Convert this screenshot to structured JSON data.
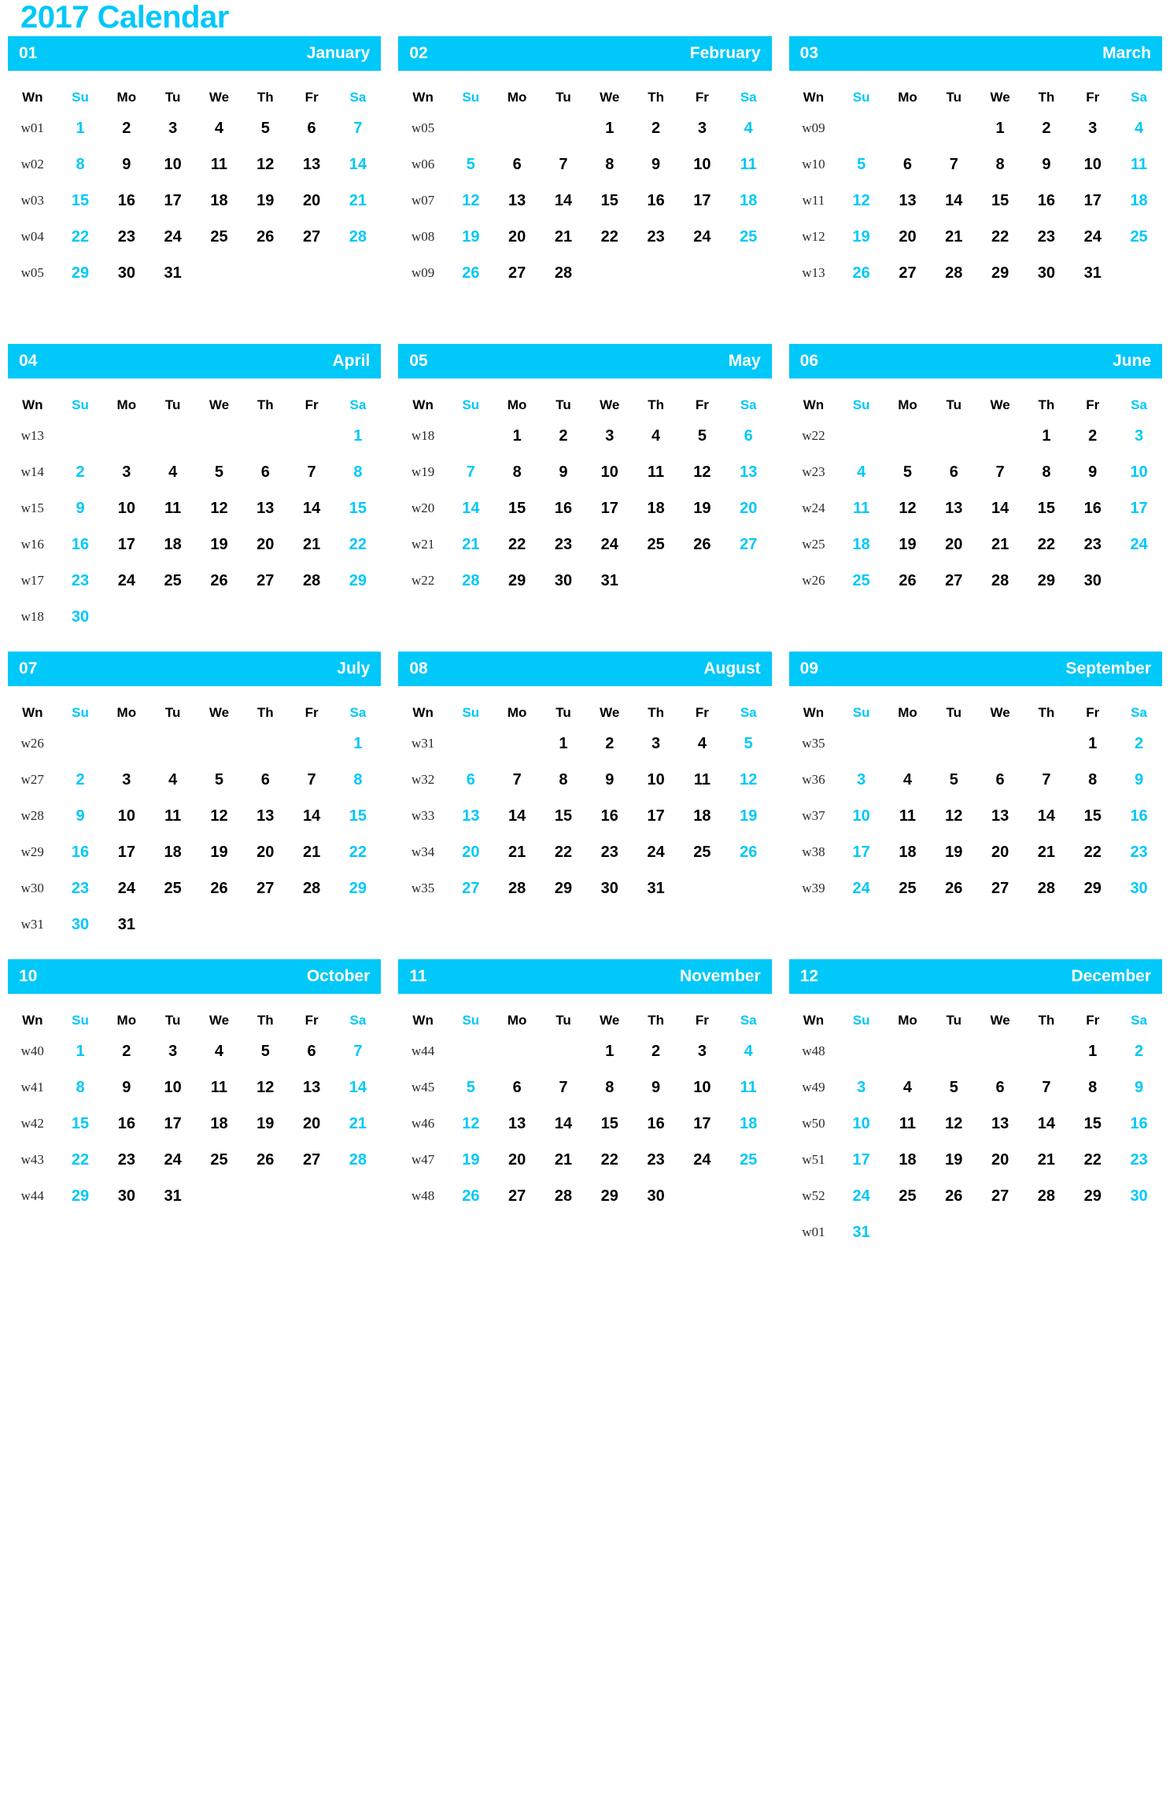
{
  "title": "2017 Calendar",
  "year": "2017",
  "colors": {
    "accent": "#00C8F8",
    "text": "#000000",
    "header_text": "#FFFFFF",
    "week_number": "#2B2B2B",
    "background": "#FFFFFF"
  },
  "day_headers": [
    {
      "label": "Wn",
      "weekend": false
    },
    {
      "label": "Su",
      "weekend": true
    },
    {
      "label": "Mo",
      "weekend": false
    },
    {
      "label": "Tu",
      "weekend": false
    },
    {
      "label": "We",
      "weekend": false
    },
    {
      "label": "Th",
      "weekend": false
    },
    {
      "label": "Fr",
      "weekend": false
    },
    {
      "label": "Sa",
      "weekend": true
    }
  ],
  "months": [
    {
      "num": "01",
      "name": "January",
      "weeks": [
        {
          "wn": "w01",
          "days": [
            "1",
            "2",
            "3",
            "4",
            "5",
            "6",
            "7"
          ]
        },
        {
          "wn": "w02",
          "days": [
            "8",
            "9",
            "10",
            "11",
            "12",
            "13",
            "14"
          ]
        },
        {
          "wn": "w03",
          "days": [
            "15",
            "16",
            "17",
            "18",
            "19",
            "20",
            "21"
          ]
        },
        {
          "wn": "w04",
          "days": [
            "22",
            "23",
            "24",
            "25",
            "26",
            "27",
            "28"
          ]
        },
        {
          "wn": "w05",
          "days": [
            "29",
            "30",
            "31",
            "",
            "",
            "",
            ""
          ]
        },
        {
          "wn": "",
          "days": [
            "",
            "",
            "",
            "",
            "",
            "",
            ""
          ]
        }
      ]
    },
    {
      "num": "02",
      "name": "February",
      "weeks": [
        {
          "wn": "w05",
          "days": [
            "",
            "",
            "",
            "1",
            "2",
            "3",
            "4"
          ]
        },
        {
          "wn": "w06",
          "days": [
            "5",
            "6",
            "7",
            "8",
            "9",
            "10",
            "11"
          ]
        },
        {
          "wn": "w07",
          "days": [
            "12",
            "13",
            "14",
            "15",
            "16",
            "17",
            "18"
          ]
        },
        {
          "wn": "w08",
          "days": [
            "19",
            "20",
            "21",
            "22",
            "23",
            "24",
            "25"
          ]
        },
        {
          "wn": "w09",
          "days": [
            "26",
            "27",
            "28",
            "",
            "",
            "",
            ""
          ]
        },
        {
          "wn": "",
          "days": [
            "",
            "",
            "",
            "",
            "",
            "",
            ""
          ]
        }
      ]
    },
    {
      "num": "03",
      "name": "March",
      "weeks": [
        {
          "wn": "w09",
          "days": [
            "",
            "",
            "",
            "1",
            "2",
            "3",
            "4"
          ]
        },
        {
          "wn": "w10",
          "days": [
            "5",
            "6",
            "7",
            "8",
            "9",
            "10",
            "11"
          ]
        },
        {
          "wn": "w11",
          "days": [
            "12",
            "13",
            "14",
            "15",
            "16",
            "17",
            "18"
          ]
        },
        {
          "wn": "w12",
          "days": [
            "19",
            "20",
            "21",
            "22",
            "23",
            "24",
            "25"
          ]
        },
        {
          "wn": "w13",
          "days": [
            "26",
            "27",
            "28",
            "29",
            "30",
            "31",
            ""
          ]
        },
        {
          "wn": "",
          "days": [
            "",
            "",
            "",
            "",
            "",
            "",
            ""
          ]
        }
      ]
    },
    {
      "num": "04",
      "name": "April",
      "weeks": [
        {
          "wn": "w13",
          "days": [
            "",
            "",
            "",
            "",
            "",
            "",
            "1"
          ]
        },
        {
          "wn": "w14",
          "days": [
            "2",
            "3",
            "4",
            "5",
            "6",
            "7",
            "8"
          ]
        },
        {
          "wn": "w15",
          "days": [
            "9",
            "10",
            "11",
            "12",
            "13",
            "14",
            "15"
          ]
        },
        {
          "wn": "w16",
          "days": [
            "16",
            "17",
            "18",
            "19",
            "20",
            "21",
            "22"
          ]
        },
        {
          "wn": "w17",
          "days": [
            "23",
            "24",
            "25",
            "26",
            "27",
            "28",
            "29"
          ]
        },
        {
          "wn": "w18",
          "days": [
            "30",
            "",
            "",
            "",
            "",
            "",
            ""
          ]
        }
      ]
    },
    {
      "num": "05",
      "name": "May",
      "weeks": [
        {
          "wn": "w18",
          "days": [
            "",
            "1",
            "2",
            "3",
            "4",
            "5",
            "6"
          ]
        },
        {
          "wn": "w19",
          "days": [
            "7",
            "8",
            "9",
            "10",
            "11",
            "12",
            "13"
          ]
        },
        {
          "wn": "w20",
          "days": [
            "14",
            "15",
            "16",
            "17",
            "18",
            "19",
            "20"
          ]
        },
        {
          "wn": "w21",
          "days": [
            "21",
            "22",
            "23",
            "24",
            "25",
            "26",
            "27"
          ]
        },
        {
          "wn": "w22",
          "days": [
            "28",
            "29",
            "30",
            "31",
            "",
            "",
            ""
          ]
        },
        {
          "wn": "",
          "days": [
            "",
            "",
            "",
            "",
            "",
            "",
            ""
          ]
        }
      ]
    },
    {
      "num": "06",
      "name": "June",
      "weeks": [
        {
          "wn": "w22",
          "days": [
            "",
            "",
            "",
            "",
            "1",
            "2",
            "3"
          ]
        },
        {
          "wn": "w23",
          "days": [
            "4",
            "5",
            "6",
            "7",
            "8",
            "9",
            "10"
          ]
        },
        {
          "wn": "w24",
          "days": [
            "11",
            "12",
            "13",
            "14",
            "15",
            "16",
            "17"
          ]
        },
        {
          "wn": "w25",
          "days": [
            "18",
            "19",
            "20",
            "21",
            "22",
            "23",
            "24"
          ]
        },
        {
          "wn": "w26",
          "days": [
            "25",
            "26",
            "27",
            "28",
            "29",
            "30",
            ""
          ]
        },
        {
          "wn": "",
          "days": [
            "",
            "",
            "",
            "",
            "",
            "",
            ""
          ]
        }
      ]
    },
    {
      "num": "07",
      "name": "July",
      "weeks": [
        {
          "wn": "w26",
          "days": [
            "",
            "",
            "",
            "",
            "",
            "",
            "1"
          ]
        },
        {
          "wn": "w27",
          "days": [
            "2",
            "3",
            "4",
            "5",
            "6",
            "7",
            "8"
          ]
        },
        {
          "wn": "w28",
          "days": [
            "9",
            "10",
            "11",
            "12",
            "13",
            "14",
            "15"
          ]
        },
        {
          "wn": "w29",
          "days": [
            "16",
            "17",
            "18",
            "19",
            "20",
            "21",
            "22"
          ]
        },
        {
          "wn": "w30",
          "days": [
            "23",
            "24",
            "25",
            "26",
            "27",
            "28",
            "29"
          ]
        },
        {
          "wn": "w31",
          "days": [
            "30",
            "31",
            "",
            "",
            "",
            "",
            ""
          ]
        }
      ]
    },
    {
      "num": "08",
      "name": "August",
      "weeks": [
        {
          "wn": "w31",
          "days": [
            "",
            "",
            "1",
            "2",
            "3",
            "4",
            "5"
          ]
        },
        {
          "wn": "w32",
          "days": [
            "6",
            "7",
            "8",
            "9",
            "10",
            "11",
            "12"
          ]
        },
        {
          "wn": "w33",
          "days": [
            "13",
            "14",
            "15",
            "16",
            "17",
            "18",
            "19"
          ]
        },
        {
          "wn": "w34",
          "days": [
            "20",
            "21",
            "22",
            "23",
            "24",
            "25",
            "26"
          ]
        },
        {
          "wn": "w35",
          "days": [
            "27",
            "28",
            "29",
            "30",
            "31",
            "",
            ""
          ]
        },
        {
          "wn": "",
          "days": [
            "",
            "",
            "",
            "",
            "",
            "",
            ""
          ]
        }
      ]
    },
    {
      "num": "09",
      "name": "September",
      "weeks": [
        {
          "wn": "w35",
          "days": [
            "",
            "",
            "",
            "",
            "",
            "1",
            "2"
          ]
        },
        {
          "wn": "w36",
          "days": [
            "3",
            "4",
            "5",
            "6",
            "7",
            "8",
            "9"
          ]
        },
        {
          "wn": "w37",
          "days": [
            "10",
            "11",
            "12",
            "13",
            "14",
            "15",
            "16"
          ]
        },
        {
          "wn": "w38",
          "days": [
            "17",
            "18",
            "19",
            "20",
            "21",
            "22",
            "23"
          ]
        },
        {
          "wn": "w39",
          "days": [
            "24",
            "25",
            "26",
            "27",
            "28",
            "29",
            "30"
          ]
        },
        {
          "wn": "",
          "days": [
            "",
            "",
            "",
            "",
            "",
            "",
            ""
          ]
        }
      ]
    },
    {
      "num": "10",
      "name": "October",
      "weeks": [
        {
          "wn": "w40",
          "days": [
            "1",
            "2",
            "3",
            "4",
            "5",
            "6",
            "7"
          ]
        },
        {
          "wn": "w41",
          "days": [
            "8",
            "9",
            "10",
            "11",
            "12",
            "13",
            "14"
          ]
        },
        {
          "wn": "w42",
          "days": [
            "15",
            "16",
            "17",
            "18",
            "19",
            "20",
            "21"
          ]
        },
        {
          "wn": "w43",
          "days": [
            "22",
            "23",
            "24",
            "25",
            "26",
            "27",
            "28"
          ]
        },
        {
          "wn": "w44",
          "days": [
            "29",
            "30",
            "31",
            "",
            "",
            "",
            ""
          ]
        },
        {
          "wn": "",
          "days": [
            "",
            "",
            "",
            "",
            "",
            "",
            ""
          ]
        }
      ]
    },
    {
      "num": "11",
      "name": "November",
      "weeks": [
        {
          "wn": "w44",
          "days": [
            "",
            "",
            "",
            "1",
            "2",
            "3",
            "4"
          ]
        },
        {
          "wn": "w45",
          "days": [
            "5",
            "6",
            "7",
            "8",
            "9",
            "10",
            "11"
          ]
        },
        {
          "wn": "w46",
          "days": [
            "12",
            "13",
            "14",
            "15",
            "16",
            "17",
            "18"
          ]
        },
        {
          "wn": "w47",
          "days": [
            "19",
            "20",
            "21",
            "22",
            "23",
            "24",
            "25"
          ]
        },
        {
          "wn": "w48",
          "days": [
            "26",
            "27",
            "28",
            "29",
            "30",
            "",
            ""
          ]
        },
        {
          "wn": "",
          "days": [
            "",
            "",
            "",
            "",
            "",
            "",
            ""
          ]
        }
      ]
    },
    {
      "num": "12",
      "name": "December",
      "weeks": [
        {
          "wn": "w48",
          "days": [
            "",
            "",
            "",
            "",
            "",
            "1",
            "2"
          ]
        },
        {
          "wn": "w49",
          "days": [
            "3",
            "4",
            "5",
            "6",
            "7",
            "8",
            "9"
          ]
        },
        {
          "wn": "w50",
          "days": [
            "10",
            "11",
            "12",
            "13",
            "14",
            "15",
            "16"
          ]
        },
        {
          "wn": "w51",
          "days": [
            "17",
            "18",
            "19",
            "20",
            "21",
            "22",
            "23"
          ]
        },
        {
          "wn": "w52",
          "days": [
            "24",
            "25",
            "26",
            "27",
            "28",
            "29",
            "30"
          ]
        },
        {
          "wn": "w01",
          "days": [
            "31",
            "",
            "",
            "",
            "",
            "",
            ""
          ]
        }
      ]
    }
  ]
}
